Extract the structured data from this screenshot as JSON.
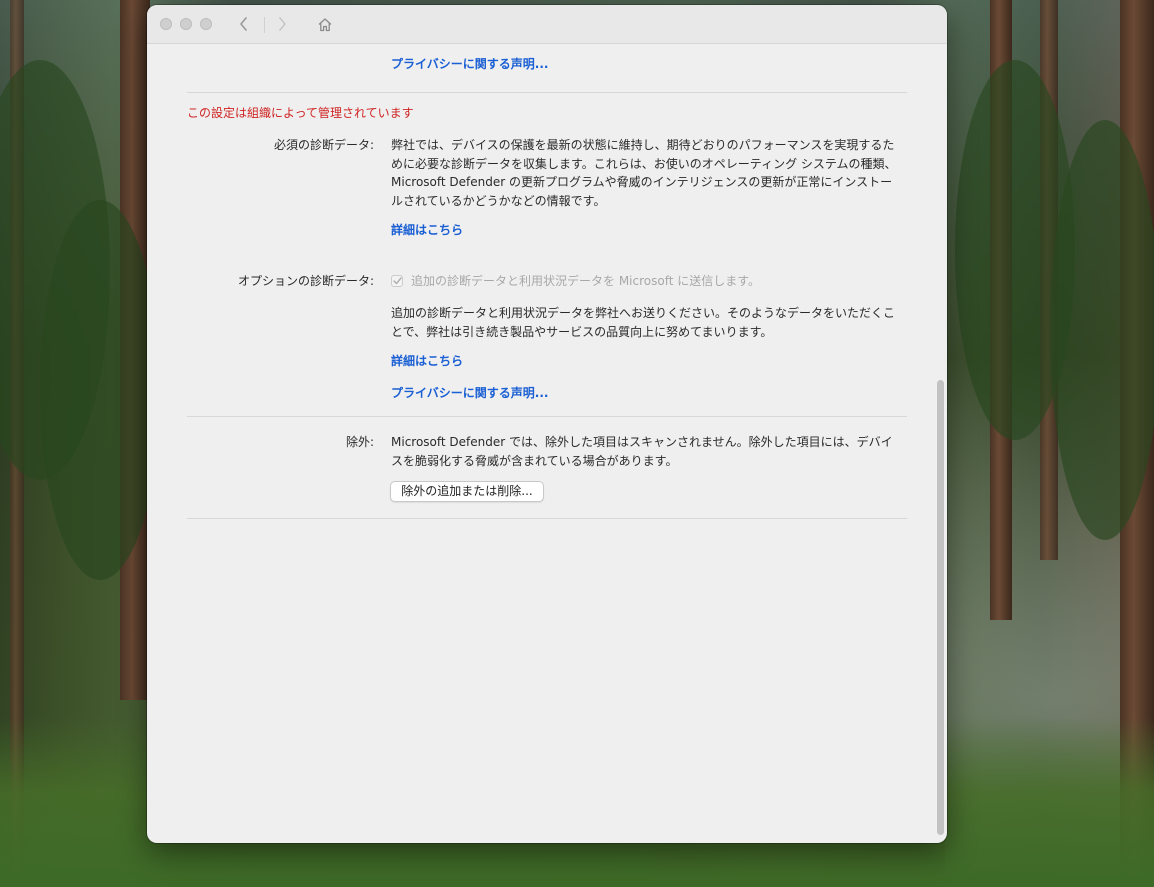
{
  "titlebar": {
    "traffic_lights": [
      "close",
      "minimize",
      "zoom"
    ],
    "nav": [
      "back-icon",
      "forward-icon",
      "home-icon"
    ]
  },
  "top_link": "プライバシーに関する声明...",
  "managed_notice": "この設定は組織によって管理されています",
  "required_diagnostics": {
    "label": "必須の診断データ:",
    "lines": [
      "弊社では、デバイスの保護を最新の状態に維持し、期待どおりのパフォーマンスを実現するた",
      "めに必要な診断データを収集します。これらは、お使いのオペレーティング システムの種類、",
      "Microsoft Defender の更新プログラムや脅威のインテリジェンスの更新が正常にインストー",
      "ルされているかどうかなどの情報です。"
    ],
    "link": "詳細はこちら"
  },
  "optional_diagnostics": {
    "label": "オプションの診断データ:",
    "checkbox_label": "追加の診断データと利用状況データを Microsoft に送信します。",
    "checkbox_checked": true,
    "checkbox_disabled": true,
    "lines": [
      "追加の診断データと利用状況データを弊社へお送りください。そのようなデータをいただくこ",
      "とで、弊社は引き続き製品やサービスの品質向上に努めてまいります。"
    ],
    "link": "詳細はこちら",
    "privacy_link": "プライバシーに関する声明..."
  },
  "exclusions": {
    "label": "除外:",
    "lines": [
      "Microsoft Defender では、除外した項目はスキャンされません。除外した項目には、デバイ",
      "スを脆弱化する脅威が含まれている場合があります。"
    ],
    "button_label": "除外の追加または削除..."
  },
  "colors": {
    "link": "#1a5fd4",
    "managed": "#d02424",
    "window_bg": "#efefef"
  }
}
